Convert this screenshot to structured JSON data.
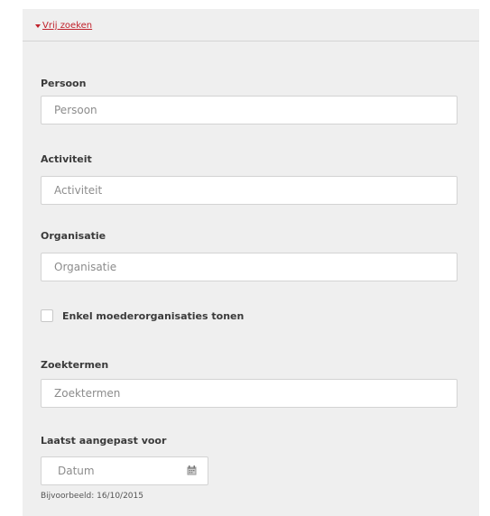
{
  "header": {
    "toggle_label": "Vrij zoeken"
  },
  "fields": {
    "persoon": {
      "label": "Persoon",
      "placeholder": "Persoon",
      "value": ""
    },
    "activiteit": {
      "label": "Activiteit",
      "placeholder": "Activiteit",
      "value": ""
    },
    "organisatie": {
      "label": "Organisatie",
      "placeholder": "Organisatie",
      "value": ""
    },
    "zoektermen": {
      "label": "Zoektermen",
      "placeholder": "Zoektermen",
      "value": ""
    },
    "datum": {
      "label": "Laatst aangepast voor",
      "placeholder": "Datum",
      "value": "",
      "example": "Bijvoorbeeld: 16/10/2015"
    }
  },
  "checkbox": {
    "label": "Enkel moederorganisaties tonen",
    "checked": false
  },
  "icons": {
    "toggle": "caret-down-icon",
    "date": "calendar-icon"
  },
  "colors": {
    "panel_background": "#efefef",
    "link": "#c0202a",
    "label_text": "#3a3a3a"
  }
}
